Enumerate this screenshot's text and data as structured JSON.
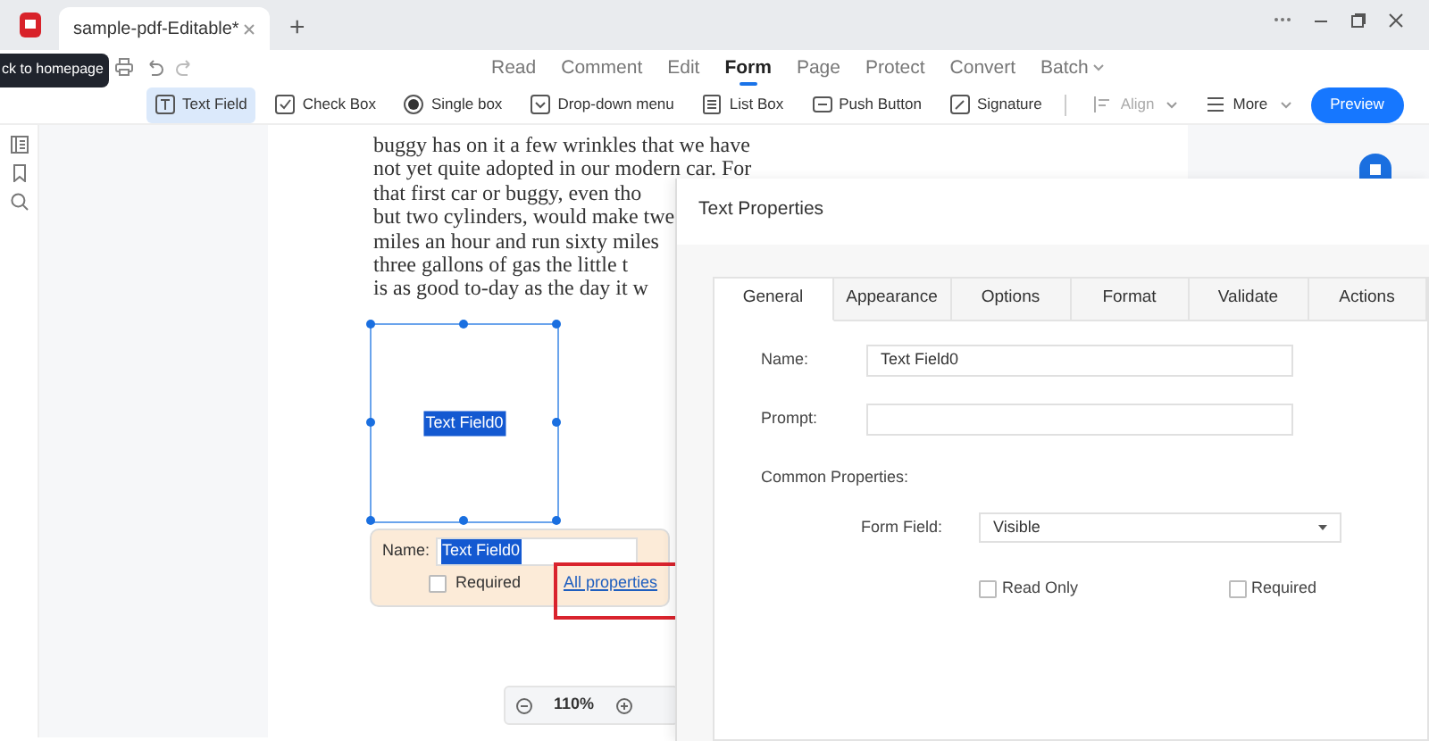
{
  "window": {
    "tab_title": "sample-pdf-Editable*",
    "tooltip": "ck to homepage",
    "new_tab": "+"
  },
  "menu": [
    {
      "label": "Read",
      "selected": false
    },
    {
      "label": "Comment",
      "selected": false
    },
    {
      "label": "Edit",
      "selected": false
    },
    {
      "label": "Form",
      "selected": true
    },
    {
      "label": "Page",
      "selected": false
    },
    {
      "label": "Protect",
      "selected": false
    },
    {
      "label": "Convert",
      "selected": false
    },
    {
      "label": "Batch",
      "selected": false,
      "kind": "dropdown"
    }
  ],
  "toolbar": [
    {
      "label": "Text Field",
      "kind": "tool",
      "selected": true,
      "disabled": false
    },
    {
      "label": "Check Box",
      "kind": "tool",
      "selected": false,
      "disabled": false
    },
    {
      "label": "Single box",
      "kind": "tool",
      "selected": false,
      "disabled": false
    },
    {
      "label": "Drop-down menu",
      "kind": "tool",
      "selected": false,
      "disabled": false
    },
    {
      "label": "List Box",
      "kind": "tool",
      "selected": false,
      "disabled": false
    },
    {
      "label": "Push Button",
      "kind": "tool",
      "selected": false,
      "disabled": false
    },
    {
      "label": "Signature",
      "kind": "tool",
      "selected": false,
      "disabled": false
    },
    {
      "label": "Align",
      "kind": "dropdown",
      "selected": false,
      "disabled": true
    },
    {
      "label": "More",
      "kind": "dropdown",
      "selected": false,
      "disabled": false
    },
    {
      "label": "Preview",
      "kind": "primary"
    }
  ],
  "document": {
    "lines": [
      "buggy has on it a few wrinkles that we have",
      "not yet quite adopted in our modern car. For",
      "that first car or buggy, even tho",
      "but two cylinders, would make twe",
      "miles an hour and run sixty miles",
      "three gallons of gas the little t",
      "is as good to-day as the day it w"
    ],
    "form_field": {
      "label": "Text Field0",
      "selected": true
    }
  },
  "field_popup": {
    "name_label": "Name:",
    "name_value": "Text Field0",
    "required_label": "Required",
    "required_checked": false,
    "link": "All properties",
    "link_highlighted": true
  },
  "zoom": {
    "level": "110%"
  },
  "dialog": {
    "title": "Text Properties",
    "tabs": [
      {
        "label": "General",
        "selected": true
      },
      {
        "label": "Appearance",
        "selected": false
      },
      {
        "label": "Options",
        "selected": false
      },
      {
        "label": "Format",
        "selected": false
      },
      {
        "label": "Validate",
        "selected": false
      },
      {
        "label": "Actions",
        "selected": false
      }
    ],
    "name_label": "Name:",
    "name_value": "Text Field0",
    "prompt_label": "Prompt:",
    "section": "Common Properties:",
    "form_field_label": "Form Field:",
    "form_field_value": "Visible",
    "checkboxes": [
      {
        "label": "Read Only",
        "checked": false
      },
      {
        "label": "Required",
        "checked": false
      }
    ]
  }
}
